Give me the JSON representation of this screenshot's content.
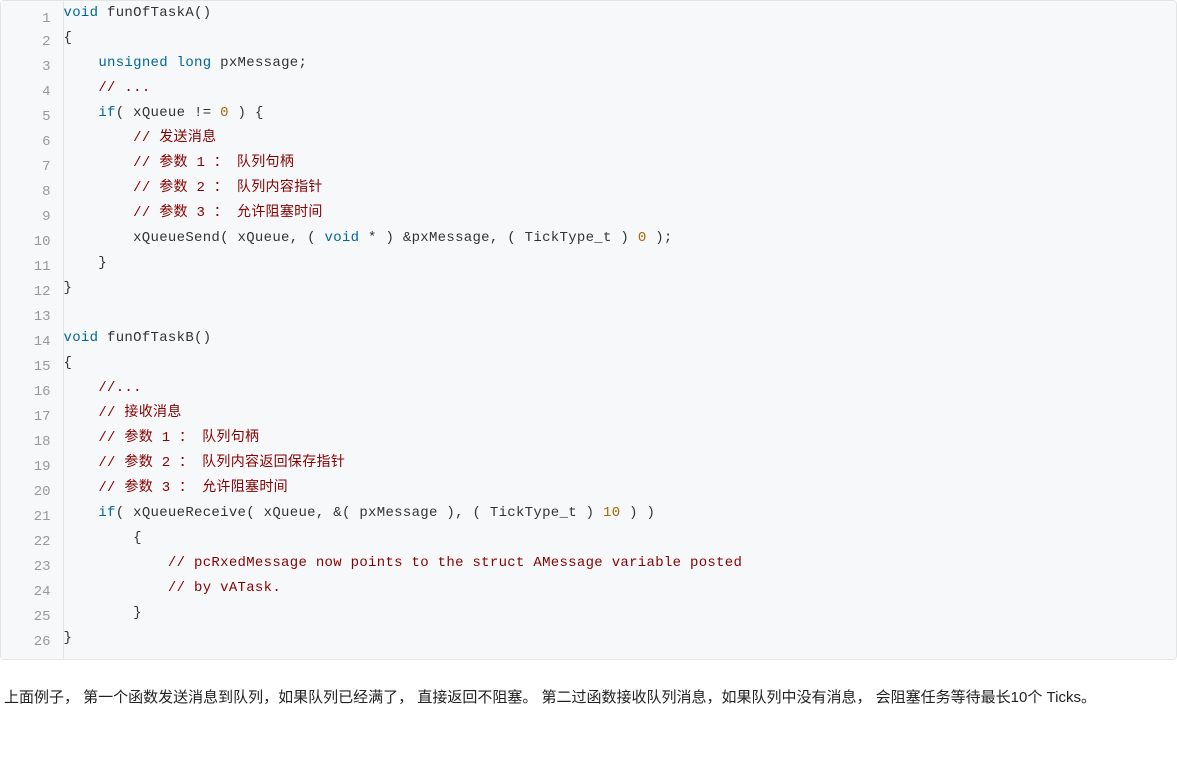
{
  "code": {
    "total_lines": 26,
    "lines": [
      [
        {
          "t": "kw",
          "v": "void"
        },
        {
          "t": "p",
          "v": " funOfTaskA()"
        }
      ],
      [
        {
          "t": "p",
          "v": "{"
        }
      ],
      [
        {
          "t": "p",
          "v": "    "
        },
        {
          "t": "type",
          "v": "unsigned"
        },
        {
          "t": "p",
          "v": " "
        },
        {
          "t": "type",
          "v": "long"
        },
        {
          "t": "p",
          "v": " pxMessage;"
        }
      ],
      [
        {
          "t": "p",
          "v": "    "
        },
        {
          "t": "cm",
          "v": "// ..."
        }
      ],
      [
        {
          "t": "p",
          "v": "    "
        },
        {
          "t": "kw",
          "v": "if"
        },
        {
          "t": "p",
          "v": "( xQueue != "
        },
        {
          "t": "num",
          "v": "0"
        },
        {
          "t": "p",
          "v": " ) {"
        }
      ],
      [
        {
          "t": "p",
          "v": "        "
        },
        {
          "t": "cm",
          "v": "// 发送消息"
        }
      ],
      [
        {
          "t": "p",
          "v": "        "
        },
        {
          "t": "cm",
          "v": "// 参数 1 ： 队列句柄"
        }
      ],
      [
        {
          "t": "p",
          "v": "        "
        },
        {
          "t": "cm",
          "v": "// 参数 2 ： 队列内容指针"
        }
      ],
      [
        {
          "t": "p",
          "v": "        "
        },
        {
          "t": "cm",
          "v": "// 参数 3 ： 允许阻塞时间"
        }
      ],
      [
        {
          "t": "p",
          "v": "        xQueueSend( xQueue, ( "
        },
        {
          "t": "cast",
          "v": "void"
        },
        {
          "t": "p",
          "v": " * ) &pxMessage, ( TickType_t ) "
        },
        {
          "t": "num",
          "v": "0"
        },
        {
          "t": "p",
          "v": " );"
        }
      ],
      [
        {
          "t": "p",
          "v": "    }"
        }
      ],
      [
        {
          "t": "p",
          "v": "}"
        }
      ],
      [
        {
          "t": "p",
          "v": ""
        }
      ],
      [
        {
          "t": "kw",
          "v": "void"
        },
        {
          "t": "p",
          "v": " funOfTaskB()"
        }
      ],
      [
        {
          "t": "p",
          "v": "{"
        }
      ],
      [
        {
          "t": "p",
          "v": "    "
        },
        {
          "t": "cm",
          "v": "//..."
        }
      ],
      [
        {
          "t": "p",
          "v": "    "
        },
        {
          "t": "cm",
          "v": "// 接收消息"
        }
      ],
      [
        {
          "t": "p",
          "v": "    "
        },
        {
          "t": "cm",
          "v": "// 参数 1 ： 队列句柄"
        }
      ],
      [
        {
          "t": "p",
          "v": "    "
        },
        {
          "t": "cm",
          "v": "// 参数 2 ： 队列内容返回保存指针"
        }
      ],
      [
        {
          "t": "p",
          "v": "    "
        },
        {
          "t": "cm",
          "v": "// 参数 3 ： 允许阻塞时间"
        }
      ],
      [
        {
          "t": "p",
          "v": "    "
        },
        {
          "t": "kw",
          "v": "if"
        },
        {
          "t": "p",
          "v": "( xQueueReceive( xQueue, &( pxMessage ), ( TickType_t ) "
        },
        {
          "t": "num",
          "v": "10"
        },
        {
          "t": "p",
          "v": " ) )"
        }
      ],
      [
        {
          "t": "p",
          "v": "        {"
        }
      ],
      [
        {
          "t": "p",
          "v": "            "
        },
        {
          "t": "cm",
          "v": "// pcRxedMessage now points to the struct AMessage variable posted"
        }
      ],
      [
        {
          "t": "p",
          "v": "            "
        },
        {
          "t": "cm",
          "v": "// by vATask."
        }
      ],
      [
        {
          "t": "p",
          "v": "        }"
        }
      ],
      [
        {
          "t": "p",
          "v": "}"
        }
      ]
    ]
  },
  "paragraph": "上面例子， 第一个函数发送消息到队列，如果队列已经满了， 直接返回不阻塞。 第二过函数接收队列消息，如果队列中没有消息， 会阻塞任务等待最长10个 Ticks。"
}
